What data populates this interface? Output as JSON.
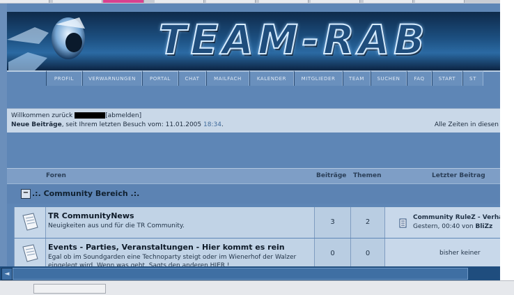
{
  "banner": {
    "logo_text": "TEAM-RAB"
  },
  "menu": [
    {
      "label": "Profil",
      "w": 52
    },
    {
      "label": "Verwarnungen",
      "w": 86
    },
    {
      "label": "Portal",
      "w": 52
    },
    {
      "label": "Chat",
      "w": 40
    },
    {
      "label": "Mailfach",
      "w": 62
    },
    {
      "label": "Kalender",
      "w": 64
    },
    {
      "label": "Mitglieder",
      "w": 70
    },
    {
      "label": "Team",
      "w": 40
    },
    {
      "label": "Suchen",
      "w": 52
    },
    {
      "label": "FAQ",
      "w": 36
    },
    {
      "label": "Start",
      "w": 44
    },
    {
      "label": "St",
      "w": 30
    }
  ],
  "welcome": {
    "prefix": "Willkommen zurück",
    "logout": "[abmelden]",
    "new_posts": "Neue Beiträge",
    "since": ", seit Ihrem letzten Besuch vom: 11.01.2005",
    "time": "18:34",
    "dot": ".",
    "timezone": "Alle Zeiten in diesen"
  },
  "table": {
    "headers": {
      "forums": "Foren",
      "posts": "Beiträge",
      "topics": "Themen",
      "last_post": "Letzter Beitrag"
    },
    "category": {
      "toggle": "−",
      "title": ".:. Community Bereich .:."
    },
    "rows": [
      {
        "title": "TR CommunityNews",
        "description": "Neuigkeiten aus und für die TR Community.",
        "posts": "3",
        "topics": "2",
        "last_title": "Community RuleZ - Verha",
        "last_meta": "Gestern, 00:40 von",
        "last_user": "BliZz"
      },
      {
        "title": "Events - Parties, Veranstaltungen - Hier kommt es rein",
        "description": "Egal ob im Soundgarden eine Technoparty steigt oder im Wienerhof der Walzer eingelegt wird. Wenn was geht. Sagts den anderen HIER !",
        "posts": "0",
        "topics": "0",
        "last_none": "bisher keiner"
      }
    ]
  },
  "scroll": {
    "left_arrow": "◄"
  }
}
